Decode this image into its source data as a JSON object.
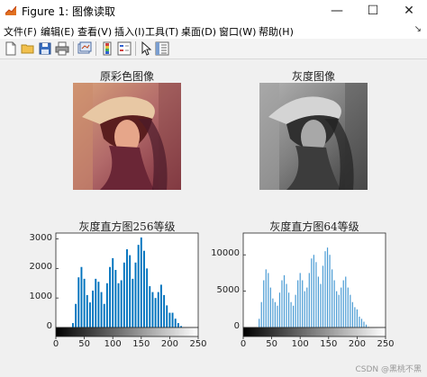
{
  "window": {
    "title": "Figure 1: 图像读取",
    "minimize_glyph": "—",
    "maximize_glyph": "☐",
    "close_glyph": "✕"
  },
  "menu": {
    "items": [
      "文件(F)",
      "编辑(E)",
      "查看(V)",
      "插入(I)",
      "工具(T)",
      "桌面(D)",
      "窗口(W)",
      "帮助(H)"
    ],
    "overflow_glyph": "↘"
  },
  "toolbar": {
    "icons": [
      "new-figure-icon",
      "open-file-icon",
      "save-icon",
      "print-icon",
      "link-plot-icon",
      "insert-colorbar-icon",
      "insert-legend-icon",
      "edit-plot-arrow-icon",
      "property-inspector-icon"
    ]
  },
  "images": [
    {
      "title": "原彩色图像"
    },
    {
      "title": "灰度图像"
    }
  ],
  "chart_data": [
    {
      "type": "bar",
      "title": "灰度直方图256等级",
      "xlim": [
        0,
        250
      ],
      "ylim": [
        0,
        3200
      ],
      "xticks": [
        "0",
        "50",
        "100",
        "150",
        "200",
        "250"
      ],
      "yticks": [
        "0",
        "1000",
        "2000",
        "3000"
      ],
      "colorbar": "gray",
      "bar_color": "#0072bd",
      "x": [
        30,
        35,
        40,
        45,
        50,
        55,
        60,
        65,
        70,
        75,
        80,
        85,
        90,
        95,
        100,
        105,
        110,
        115,
        120,
        125,
        130,
        135,
        140,
        145,
        150,
        155,
        160,
        165,
        170,
        175,
        180,
        185,
        190,
        195,
        200,
        205,
        210,
        215,
        220
      ],
      "values": [
        150,
        800,
        1700,
        2050,
        1650,
        1100,
        850,
        1250,
        1650,
        1550,
        1200,
        800,
        1500,
        2050,
        2350,
        1950,
        1500,
        1600,
        2200,
        2650,
        2450,
        1650,
        2200,
        2800,
        3050,
        2600,
        2000,
        1400,
        1200,
        1000,
        1200,
        1450,
        1100,
        750,
        500,
        500,
        300,
        150,
        50
      ]
    },
    {
      "type": "bar",
      "title": "灰度直方图64等级",
      "xlim": [
        0,
        250
      ],
      "ylim": [
        0,
        13000
      ],
      "xticks": [
        "0",
        "50",
        "100",
        "150",
        "200",
        "250"
      ],
      "yticks": [
        "0",
        "5000",
        "10000"
      ],
      "colorbar": "gray",
      "bar_color": "#4a9bd4",
      "x": [
        28,
        32,
        36,
        40,
        44,
        48,
        52,
        56,
        60,
        64,
        68,
        72,
        76,
        80,
        84,
        88,
        92,
        96,
        100,
        104,
        108,
        112,
        116,
        120,
        124,
        128,
        132,
        136,
        140,
        144,
        148,
        152,
        156,
        160,
        164,
        168,
        172,
        176,
        180,
        184,
        188,
        192,
        196,
        200,
        204,
        208,
        212,
        216,
        220
      ],
      "values": [
        1200,
        3500,
        6500,
        8000,
        7500,
        5500,
        4000,
        3500,
        3000,
        4800,
        6500,
        7200,
        6000,
        4800,
        3500,
        3000,
        4500,
        6500,
        7500,
        6500,
        5000,
        5500,
        7500,
        9500,
        10000,
        9000,
        7000,
        6000,
        8500,
        10500,
        11000,
        10000,
        8000,
        6500,
        5000,
        4500,
        5500,
        6500,
        7000,
        5500,
        4500,
        3500,
        2800,
        2500,
        1500,
        1200,
        800,
        400,
        100
      ]
    }
  ],
  "watermark": "CSDN @黑桃不黑"
}
